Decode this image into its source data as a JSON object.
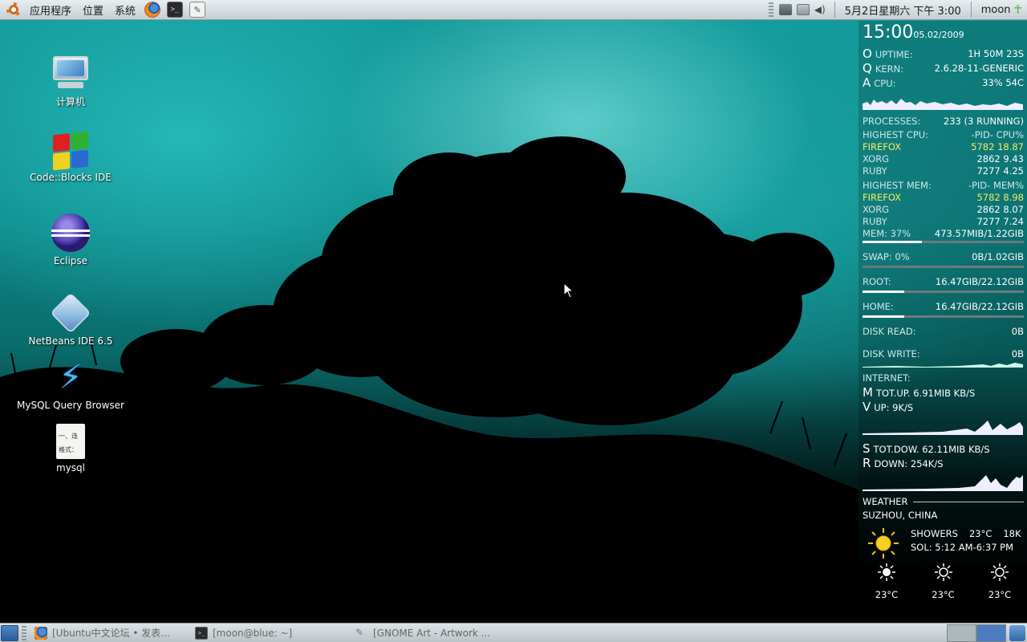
{
  "top_panel": {
    "menus": [
      "应用程序",
      "位置",
      "系统"
    ],
    "launchers": [
      "firefox-icon",
      "terminal-icon",
      "text-editor-icon"
    ],
    "clock": "5月2日星期六 下午 3:00",
    "user": "moon"
  },
  "desktop_icons": [
    {
      "label": "计算机",
      "icon": "computer-icon"
    },
    {
      "label": "Code::Blocks IDE",
      "icon": "codeblocks-icon"
    },
    {
      "label": "Eclipse",
      "icon": "eclipse-icon"
    },
    {
      "label": "NetBeans IDE 6.5",
      "icon": "netbeans-icon"
    },
    {
      "label": "MySQL Query Browser",
      "icon": "mysql-icon"
    },
    {
      "label": "mysql",
      "icon": "text-file-icon"
    }
  ],
  "file_icon_text": [
    "一、连",
    "格式："
  ],
  "conky": {
    "time": "15:00",
    "date": "05.02/2009",
    "uptime_glyph": "O",
    "uptime_label": "UPTIME:",
    "uptime": "1H 50M 23S",
    "kern_glyph": "Q",
    "kern_label": "KERN:",
    "kern": "2.6.28-11-GENERIC",
    "cpu_glyph": "A",
    "cpu_label": "CPU:",
    "cpu": "33% 54C",
    "processes_label": "PROCESSES:",
    "processes": "233  (3 RUNNING)",
    "high_cpu": {
      "title": "HIGHEST CPU:",
      "cols": "-PID-   CPU%",
      "rows": [
        {
          "name": "FIREFOX",
          "value": "5782  18.87"
        },
        {
          "name": "XORG",
          "value": "2862   9.43"
        },
        {
          "name": "RUBY",
          "value": "7277   4.25"
        }
      ]
    },
    "high_mem": {
      "title": "HIGHEST MEM:",
      "cols": "-PID-   MEM%",
      "rows": [
        {
          "name": "FIREFOX",
          "value": "5782   8.98"
        },
        {
          "name": "XORG",
          "value": "2862   8.07"
        },
        {
          "name": "RUBY",
          "value": "7277   7.24"
        }
      ]
    },
    "mem_label": "MEM: 37%",
    "mem": "473.57MIB/1.22GIB",
    "mem_fraction": 0.37,
    "swap_label": "SWAP: 0%",
    "swap": "0B/1.02GIB",
    "swap_fraction": 0,
    "root_label": "ROOT:",
    "root": "16.47GIB/22.12GIB",
    "root_fraction": 0.26,
    "home_label": "HOME:",
    "home": "16.47GIB/22.12GIB",
    "home_fraction": 0.26,
    "disk_read_label": "DISK READ:",
    "disk_read": "0B",
    "disk_write_label": "DISK WRITE:",
    "disk_write": "0B",
    "internet_label": "INTERNET:",
    "tot_up_glyph": "M",
    "tot_up": "TOT.UP. 6.91MIB KB/S",
    "up_glyph": "V",
    "up": "UP: 9K/S",
    "tot_down_glyph": "S",
    "tot_down": "TOT.DOW. 62.11MIB KB/S",
    "down_glyph": "R",
    "down": "DOWN: 254K/S",
    "weather_label": "WEATHER",
    "location": "SUZHOU, CHINA",
    "condition": "SHOWERS",
    "temp": "23°C",
    "wind": "18K",
    "sol": "SOL: 5:12 AM-6:37 PM",
    "forecast": [
      "23°C",
      "23°C",
      "23°C"
    ]
  },
  "taskbar": {
    "tasks": [
      {
        "label": "[Ubuntu中文论坛 • 发表...",
        "icon": "firefox-icon"
      },
      {
        "label": "[moon@blue: ~]",
        "icon": "terminal-icon"
      },
      {
        "label": "[GNOME Art - Artwork ...",
        "icon": "gnome-art-icon"
      }
    ]
  },
  "colors": {
    "highlight": "#f0ef60",
    "panel_top": "#e8eef0",
    "wallpaper_teal": "#139a9a"
  }
}
